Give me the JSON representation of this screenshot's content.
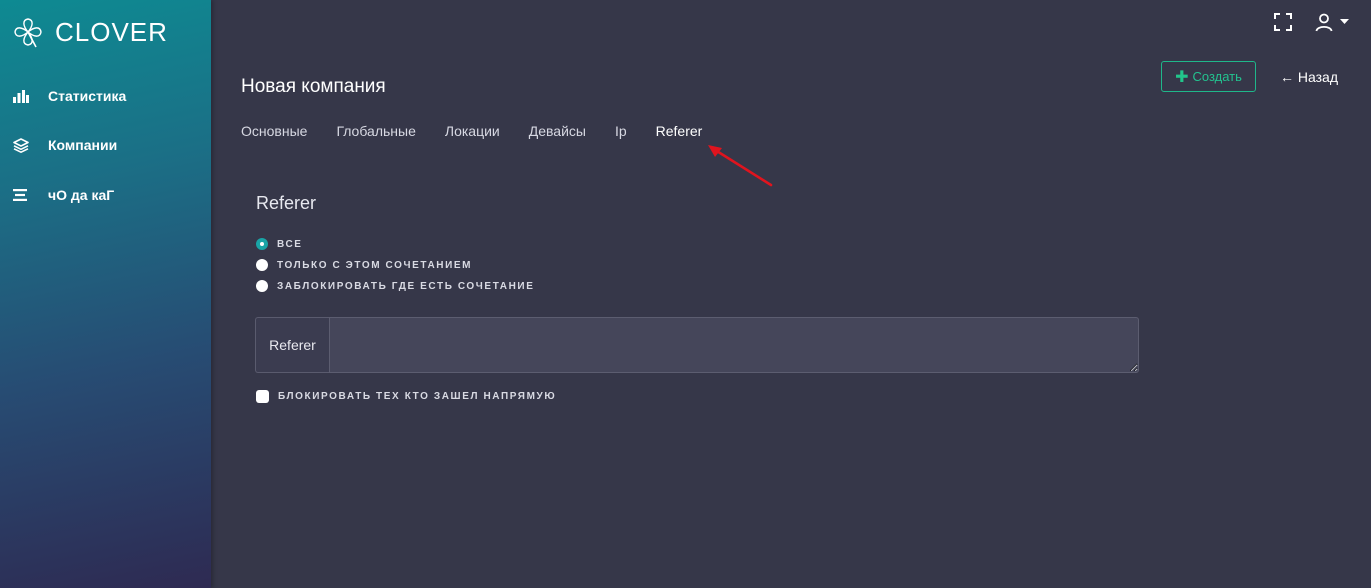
{
  "brand": {
    "name": "CLOVER",
    "icon": "clover-logo-icon"
  },
  "sidebar": {
    "items": [
      {
        "label": "Статистика",
        "icon": "bar-chart-icon"
      },
      {
        "label": "Компании",
        "icon": "layers-icon"
      },
      {
        "label": "чО да каГ",
        "icon": "list-icon"
      }
    ]
  },
  "topbar": {
    "fullscreen_icon": "fullscreen-icon",
    "user_icon": "user-icon"
  },
  "page": {
    "title": "Новая компания"
  },
  "actions": {
    "create_label": "Создать",
    "back_label": "← Назад"
  },
  "tabs": [
    {
      "label": "Основные"
    },
    {
      "label": "Глобальные"
    },
    {
      "label": "Локации"
    },
    {
      "label": "Девайсы"
    },
    {
      "label": "Ip"
    },
    {
      "label": "Referer",
      "active": true
    }
  ],
  "section": {
    "title": "Referer",
    "options": [
      {
        "label": "ВСЕ",
        "checked": true
      },
      {
        "label": "ТОЛЬКО С ЭТОМ СОЧЕТАНИЕМ",
        "checked": false
      },
      {
        "label": "ЗАБЛОКИРОВАТЬ ГДЕ ЕСТЬ СОЧЕТАНИЕ",
        "checked": false
      }
    ],
    "input_addon": "Referer",
    "input_value": "",
    "checkbox_label": "БЛОКИРОВАТЬ ТЕХ КТО ЗАШЕЛ НАПРЯМУЮ",
    "checkbox_checked": false
  },
  "colors": {
    "accent": "#19a4a6",
    "success": "#23c28f",
    "annotation_arrow": "#e0141e",
    "background": "#363749"
  }
}
